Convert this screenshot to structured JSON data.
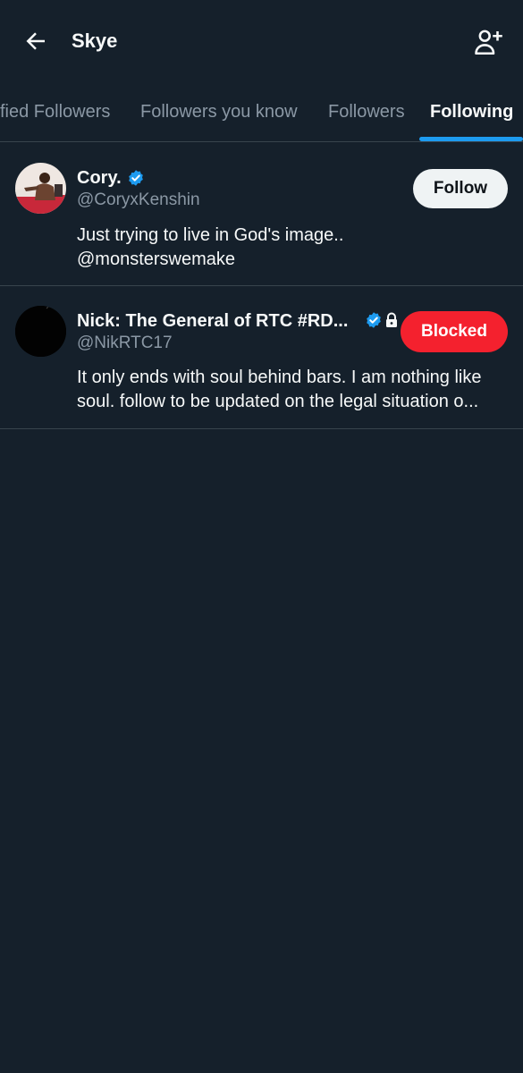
{
  "header": {
    "title": "Skye"
  },
  "tabs": [
    {
      "label": "fied Followers"
    },
    {
      "label": "Followers you know"
    },
    {
      "label": "Followers"
    },
    {
      "label": "Following",
      "active": true
    }
  ],
  "users": [
    {
      "name": "Cory.",
      "handle": "@CoryxKenshin",
      "verified": true,
      "bio_line1": "Just trying to live in God's image..",
      "bio_line2": "@monsterswemake",
      "button": "Follow"
    },
    {
      "name": "Nick: The General of RTC #RD...",
      "handle": "@NikRTC17",
      "verified": true,
      "protected": true,
      "bio_line1": "It only ends with soul behind bars. I am nothing like",
      "bio_line2": "soul. follow to be updated on the legal situation o...",
      "button": "Blocked"
    }
  ],
  "colors": {
    "background": "#15202b",
    "accent": "#1d9bf0",
    "blocked": "#f4212e",
    "divider": "#38444d"
  },
  "icons": [
    "back-arrow-icon",
    "add-user-icon",
    "verified-badge-icon",
    "lock-icon"
  ]
}
